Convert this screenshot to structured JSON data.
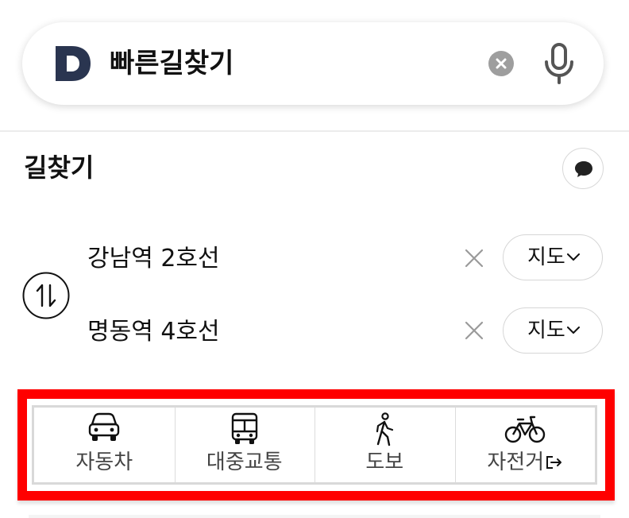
{
  "search": {
    "query": "빠른길찾기",
    "logo_icon": "daum-d-logo",
    "clear_icon": "clear-circle-icon",
    "mic_icon": "microphone-icon"
  },
  "section": {
    "title": "길찾기",
    "feedback_icon": "speech-bubble-icon"
  },
  "route": {
    "swap_icon": "swap-arrows-icon",
    "origin": "강남역 2호선",
    "destination": "명동역 4호선",
    "map_button_label": "지도"
  },
  "modes": [
    {
      "label": "자동차",
      "icon": "car-icon"
    },
    {
      "label": "대중교통",
      "icon": "bus-icon"
    },
    {
      "label": "도보",
      "icon": "walk-icon"
    },
    {
      "label": "자전거",
      "icon": "bicycle-icon"
    }
  ],
  "colors": {
    "highlight_border": "#ff0000",
    "logo": "#2a3550"
  }
}
